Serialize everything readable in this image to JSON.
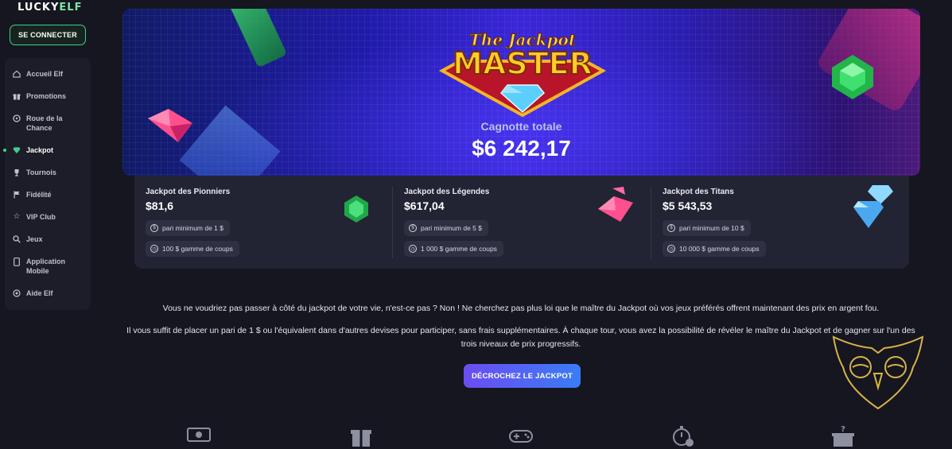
{
  "brand": {
    "logo_main": "LUCKY",
    "logo_accent": "ELF"
  },
  "sidebar": {
    "login_label": "SE CONNECTER",
    "items": [
      {
        "label": "Accueil Elf",
        "icon": "home-icon"
      },
      {
        "label": "Promotions",
        "icon": "gift-icon"
      },
      {
        "label": "Roue de la Chance",
        "icon": "wheel-icon"
      },
      {
        "label": "Jackpot",
        "icon": "gem-icon",
        "active": true
      },
      {
        "label": "Tournois",
        "icon": "trophy-icon"
      },
      {
        "label": "Fidélité",
        "icon": "flag-icon"
      },
      {
        "label": "VIP Club",
        "icon": "star-icon"
      },
      {
        "label": "Jeux",
        "icon": "search-icon"
      },
      {
        "label": "Application Mobile",
        "icon": "mobile-icon"
      },
      {
        "label": "Aide Elf",
        "icon": "help-icon"
      }
    ]
  },
  "banner": {
    "logo_line1": "The Jackpot",
    "logo_line2": "MASTER",
    "total_label": "Cagnotte totale",
    "total_value": "$6 242,17"
  },
  "tiers": [
    {
      "title": "Jackpot des Pionniers",
      "value": "$81,6",
      "min_bet": "pari minimum de 1 $",
      "range": "100 $ gamme de coups",
      "gem": "green-gem-icon"
    },
    {
      "title": "Jackpot des Légendes",
      "value": "$617,04",
      "min_bet": "pari minimum de 5 $",
      "range": "1 000 $ gamme de coups",
      "gem": "pink-gem-icon"
    },
    {
      "title": "Jackpot des Titans",
      "value": "$5 543,53",
      "min_bet": "pari minimum de 10 $",
      "range": "10 000 $ gamme de coups",
      "gem": "blue-gem-icon"
    }
  ],
  "intro": {
    "line1": "Vous ne voudriez pas passer à côté du jackpot de votre vie, n'est-ce pas ? Non ! Ne cherchez pas plus loi que le maître du Jackpot où vos jeux préférés offrent maintenant des prix en argent fou.",
    "line2": "Il vous suffit de placer un pari de 1 $ ou l'équivalent dans d'autres devises pour participer, sans frais supplémentaires. À chaque tour, vous avez la possibilité de révéler le maître du Jackpot et de gagner sur l'un des",
    "line3": "trois niveaux de prix progressifs."
  },
  "cta_label": "DÉCROCHEZ LE JACKPOT",
  "bottom_icons": [
    "money-icon",
    "gift-box-icon",
    "gamepad-icon",
    "stopwatch-icon",
    "mystery-box-icon"
  ],
  "colors": {
    "accent_green": "#3fcf8e",
    "cta_start": "#6b4df0",
    "cta_end": "#3a7cf6",
    "background": "#15161f"
  }
}
